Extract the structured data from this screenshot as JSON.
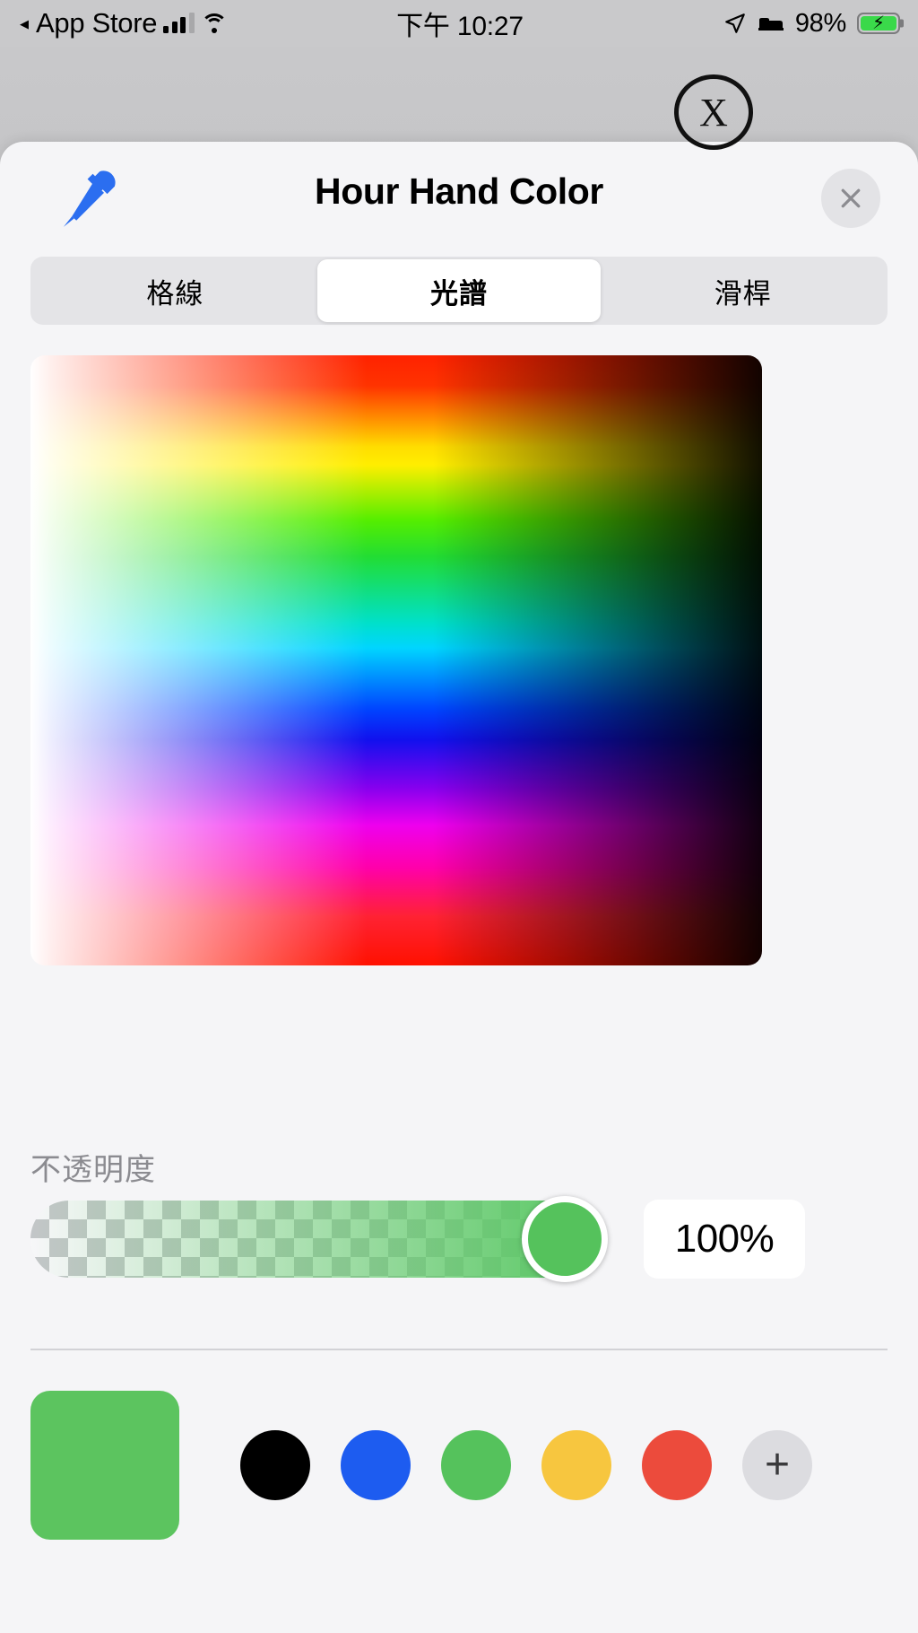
{
  "status_bar": {
    "back_arrow": "◀",
    "back_app": "App Store",
    "signal_icon": "cellular-bars-icon",
    "wifi_icon": "wifi-icon",
    "time": "下午 10:27",
    "location_icon": "location-arrow-icon",
    "focus_icon": "sleep-bed-icon",
    "battery_percent": "98%",
    "battery_icon": "battery-charging-icon",
    "battery_fill_color": "#3ad94a"
  },
  "backdrop": {
    "close_button_label": "X"
  },
  "sheet": {
    "title": "Hour Hand Color",
    "eyedropper_icon": "eyedropper-icon",
    "eyedropper_color": "#2b6ef0",
    "close_icon": "close-x-icon",
    "segmented": {
      "selected_index": 1,
      "options": [
        {
          "label": "格線"
        },
        {
          "label": "光譜"
        },
        {
          "label": "滑桿"
        }
      ]
    },
    "spectrum": {
      "name": "color-spectrum-field"
    },
    "opacity": {
      "label": "不透明度",
      "value": "100%",
      "percent": 100,
      "thumb_color": "#55c25c"
    },
    "swatches": {
      "current_color": "#5cc45f",
      "items": [
        {
          "name": "swatch-black",
          "color": "#000000"
        },
        {
          "name": "swatch-blue",
          "color": "#1d5cf0"
        },
        {
          "name": "swatch-green",
          "color": "#55c25c"
        },
        {
          "name": "swatch-yellow",
          "color": "#f7c63f"
        },
        {
          "name": "swatch-red",
          "color": "#ec4b3c"
        }
      ],
      "add_label": "+"
    }
  }
}
